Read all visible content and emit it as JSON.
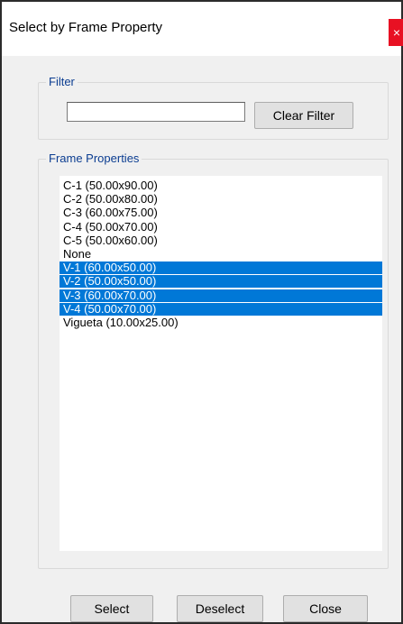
{
  "window": {
    "title": "Select by Frame Property",
    "close_glyph": "×"
  },
  "filter": {
    "group_label": "Filter",
    "input_value": "",
    "clear_button": "Clear Filter"
  },
  "properties": {
    "group_label": "Frame Properties",
    "items": [
      {
        "label": "C-1 (50.00x90.00)",
        "selected": false
      },
      {
        "label": "C-2 (50.00x80.00)",
        "selected": false
      },
      {
        "label": "C-3 (60.00x75.00)",
        "selected": false
      },
      {
        "label": "C-4 (50.00x70.00)",
        "selected": false
      },
      {
        "label": "C-5 (50.00x60.00)",
        "selected": false
      },
      {
        "label": "None",
        "selected": false
      },
      {
        "label": "V-1 (60.00x50.00)",
        "selected": true
      },
      {
        "label": "V-2 (50.00x50.00)",
        "selected": true
      },
      {
        "label": "V-3 (60.00x70.00)",
        "selected": true
      },
      {
        "label": "V-4 (50.00x70.00)",
        "selected": true
      },
      {
        "label": "Vigueta (10.00x25.00)",
        "selected": false
      }
    ]
  },
  "buttons": {
    "select": "Select",
    "deselect": "Deselect",
    "close": "Close"
  },
  "colors": {
    "selection": "#0078d7",
    "group_label": "#0b3d91",
    "close_button": "#e81123"
  }
}
